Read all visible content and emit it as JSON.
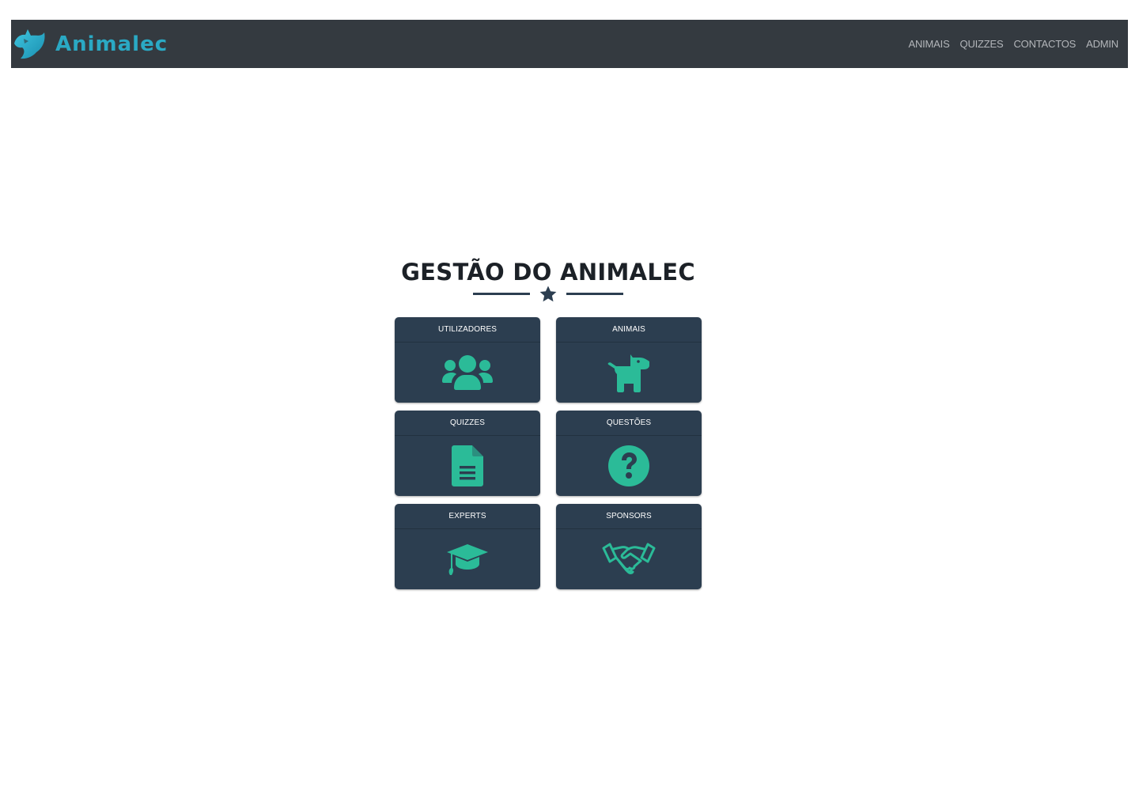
{
  "navbar": {
    "brand": "Animalec",
    "links": [
      "ANIMAIS",
      "QUIZZES",
      "CONTACTOS",
      "ADMIN"
    ]
  },
  "main": {
    "title": "GESTÃO DO ANIMALEC",
    "cards": [
      {
        "label": "UTILIZADORES",
        "icon": "users-icon"
      },
      {
        "label": "ANIMAIS",
        "icon": "dog-icon"
      },
      {
        "label": "QUIZZES",
        "icon": "file-icon"
      },
      {
        "label": "QUESTÕES",
        "icon": "question-circle-icon"
      },
      {
        "label": "EXPERTS",
        "icon": "graduation-cap-icon"
      },
      {
        "label": "SPONSORS",
        "icon": "handshake-icon"
      }
    ]
  },
  "colors": {
    "navbar_bg": "#343a40",
    "brand": "#2aa9c4",
    "card_bg": "#2c3e50",
    "icon_accent": "#2bbb98"
  }
}
